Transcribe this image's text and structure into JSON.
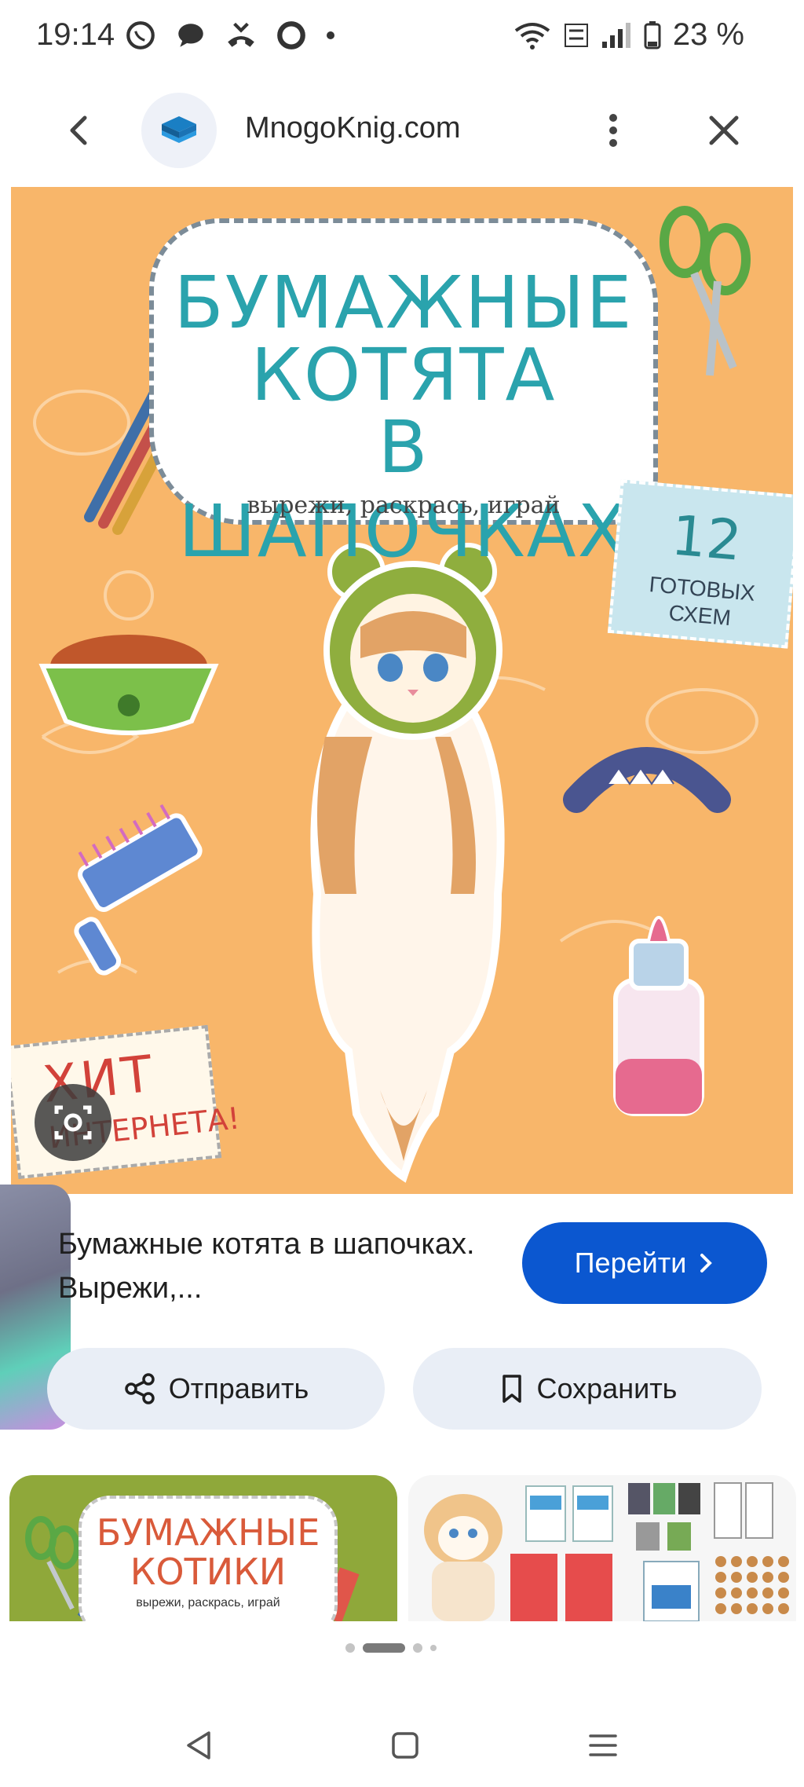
{
  "status_bar": {
    "time": "19:14",
    "battery": "23 %"
  },
  "topnav": {
    "site_name": "MnogoKnig.com",
    "icons": [
      "back-arrow-icon",
      "site-logo-icon",
      "more-vert-icon",
      "close-icon"
    ]
  },
  "cover": {
    "title_line1": "БУМАЖНЫЕ",
    "title_line2": "КОТЯТА",
    "title_line3": "В ШАПОЧКАХ",
    "subtitle": "вырежи, раскрась, играй",
    "count_number": "12",
    "count_line1": "ГОТОВЫХ",
    "count_line2": "СХЕМ",
    "hit_line1": "ХИТ",
    "hit_line2": "ИНТЕРНЕТА!"
  },
  "result": {
    "title": "Бумажные котята в шапочках. Вырежи,...",
    "go_label": "Перейти",
    "share_label": "Отправить",
    "save_label": "Сохранить"
  },
  "related": {
    "thumb1_line1": "БУМАЖНЫЕ",
    "thumb1_line2": "КОТИКИ",
    "thumb1_line3": "вырежи, раскрась, играй"
  },
  "colors": {
    "accent": "#0b57d0",
    "cover_bg": "#f8b66a",
    "title_teal": "#2aa3ad",
    "chip_bg": "#e9eef6"
  }
}
